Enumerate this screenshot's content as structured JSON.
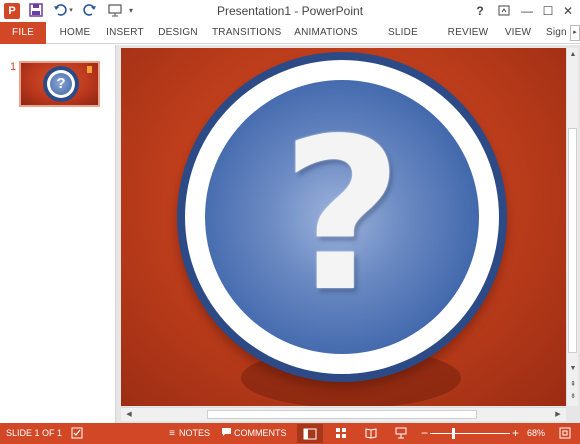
{
  "window": {
    "title": "Presentation1 - PowerPoint",
    "app_icon_letter": "P",
    "quick_access": [
      "save-icon",
      "undo-icon",
      "redo-icon",
      "start-from-beginning-icon",
      "customize-icon"
    ],
    "controls": {
      "help": "?",
      "ribbon_display": "⧉",
      "minimize": "—",
      "maximize": "☐",
      "close": "✕"
    }
  },
  "ribbon": {
    "tabs": [
      "FILE",
      "HOME",
      "INSERT",
      "DESIGN",
      "TRANSITIONS",
      "ANIMATIONS",
      "SLIDE SHOW",
      "REVIEW",
      "VIEW",
      "Sign"
    ],
    "scroll_glyph": "▸"
  },
  "thumbnails": [
    {
      "number": "1",
      "glyph": "?"
    }
  ],
  "slide": {
    "glyph": "?"
  },
  "scrollbars": {
    "up": "▲",
    "down": "▼",
    "prev_slide": "⇞",
    "next_slide": "⇟",
    "left": "◀",
    "right": "▶"
  },
  "statusbar": {
    "slide_info": "SLIDE 1 OF 1",
    "notes": "NOTES",
    "comments": "COMMENTS",
    "zoom_minus": "−",
    "zoom_plus": "+",
    "zoom_level": "68%",
    "zoom_fraction": 0.68
  },
  "colors": {
    "accent": "#d24726",
    "slide_ring": "#2b4a86",
    "slide_core": "#3f66ab"
  }
}
